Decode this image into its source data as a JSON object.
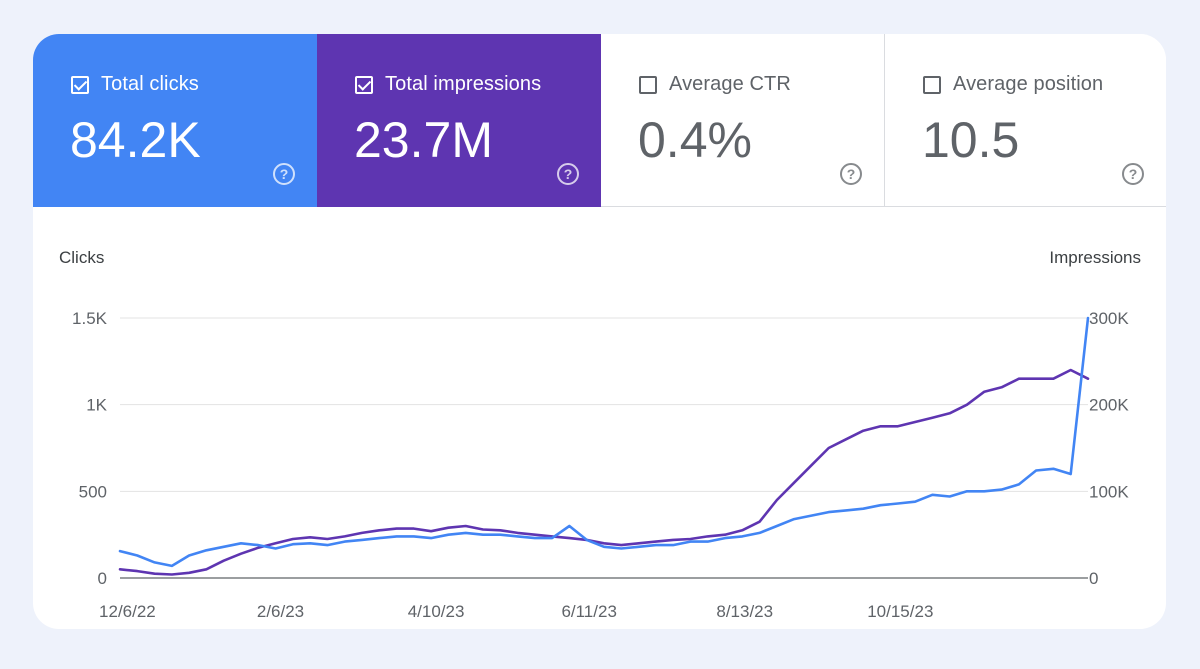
{
  "metrics": [
    {
      "label": "Total clicks",
      "value": "84.2K",
      "checked": true,
      "color": "#4285f4"
    },
    {
      "label": "Total impressions",
      "value": "23.7M",
      "checked": true,
      "color": "#5e35b1"
    },
    {
      "label": "Average CTR",
      "value": "0.4%",
      "checked": false
    },
    {
      "label": "Average position",
      "value": "10.5",
      "checked": false
    }
  ],
  "help_glyph": "?",
  "chart_data": {
    "type": "line",
    "y_left_label": "Clicks",
    "y_right_label": "Impressions",
    "y_left_ticks": [
      "0",
      "500",
      "1K",
      "1.5K"
    ],
    "y_left_range": [
      0,
      1500
    ],
    "y_right_ticks": [
      "0",
      "100K",
      "200K",
      "300K"
    ],
    "y_right_range": [
      0,
      300000
    ],
    "x_tick_labels": [
      "12/6/22",
      "2/6/23",
      "4/10/23",
      "6/11/23",
      "8/13/23",
      "10/15/23"
    ],
    "x_tick_dates": [
      "2022-12-06",
      "2023-02-06",
      "2023-04-10",
      "2023-06-11",
      "2023-08-13",
      "2023-10-15"
    ],
    "x_range": [
      "2022-12-03",
      "2023-12-30"
    ],
    "grid": true,
    "series": [
      {
        "name": "Total clicks",
        "axis": "left",
        "color": "#4285f4",
        "dates": [
          "2022-12-03",
          "2022-12-10",
          "2022-12-17",
          "2022-12-24",
          "2022-12-31",
          "2023-01-07",
          "2023-01-14",
          "2023-01-21",
          "2023-01-28",
          "2023-02-04",
          "2023-02-11",
          "2023-02-18",
          "2023-02-25",
          "2023-03-04",
          "2023-03-11",
          "2023-03-18",
          "2023-03-25",
          "2023-04-01",
          "2023-04-08",
          "2023-04-15",
          "2023-04-22",
          "2023-04-29",
          "2023-05-06",
          "2023-05-13",
          "2023-05-20",
          "2023-05-27",
          "2023-06-03",
          "2023-06-10",
          "2023-06-17",
          "2023-06-24",
          "2023-07-01",
          "2023-07-08",
          "2023-07-15",
          "2023-07-22",
          "2023-07-29",
          "2023-08-05",
          "2023-08-12",
          "2023-08-19",
          "2023-08-26",
          "2023-09-02",
          "2023-09-09",
          "2023-09-16",
          "2023-09-23",
          "2023-09-30",
          "2023-10-07",
          "2023-10-14",
          "2023-10-21",
          "2023-10-28",
          "2023-11-04",
          "2023-11-11",
          "2023-11-18",
          "2023-11-25",
          "2023-12-02",
          "2023-12-09",
          "2023-12-16",
          "2023-12-23",
          "2023-12-30"
        ],
        "values": [
          155,
          130,
          90,
          70,
          130,
          160,
          180,
          200,
          190,
          170,
          195,
          200,
          190,
          210,
          220,
          230,
          240,
          240,
          230,
          250,
          260,
          250,
          250,
          240,
          230,
          230,
          300,
          220,
          180,
          170,
          180,
          190,
          190,
          210,
          210,
          230,
          240,
          260,
          300,
          340,
          360,
          380,
          390,
          400,
          420,
          430,
          440,
          480,
          470,
          500,
          500,
          510,
          540,
          620,
          630,
          600,
          1500
        ]
      },
      {
        "name": "Total impressions",
        "axis": "right",
        "color": "#5e35b1",
        "dates": [
          "2022-12-03",
          "2022-12-10",
          "2022-12-17",
          "2022-12-24",
          "2022-12-31",
          "2023-01-07",
          "2023-01-14",
          "2023-01-21",
          "2023-01-28",
          "2023-02-04",
          "2023-02-11",
          "2023-02-18",
          "2023-02-25",
          "2023-03-04",
          "2023-03-11",
          "2023-03-18",
          "2023-03-25",
          "2023-04-01",
          "2023-04-08",
          "2023-04-15",
          "2023-04-22",
          "2023-04-29",
          "2023-05-06",
          "2023-05-13",
          "2023-05-20",
          "2023-05-27",
          "2023-06-03",
          "2023-06-10",
          "2023-06-17",
          "2023-06-24",
          "2023-07-01",
          "2023-07-08",
          "2023-07-15",
          "2023-07-22",
          "2023-07-29",
          "2023-08-05",
          "2023-08-12",
          "2023-08-19",
          "2023-08-26",
          "2023-09-02",
          "2023-09-09",
          "2023-09-16",
          "2023-09-23",
          "2023-09-30",
          "2023-10-07",
          "2023-10-14",
          "2023-10-21",
          "2023-10-28",
          "2023-11-04",
          "2023-11-11",
          "2023-11-18",
          "2023-11-25",
          "2023-12-02",
          "2023-12-09",
          "2023-12-16",
          "2023-12-23",
          "2023-12-30"
        ],
        "values": [
          10000,
          8000,
          5000,
          4000,
          6000,
          10000,
          20000,
          28000,
          35000,
          40000,
          45000,
          47000,
          45000,
          48000,
          52000,
          55000,
          57000,
          57000,
          54000,
          58000,
          60000,
          56000,
          55000,
          52000,
          50000,
          48000,
          46000,
          44000,
          40000,
          38000,
          40000,
          42000,
          44000,
          45000,
          48000,
          50000,
          55000,
          65000,
          90000,
          110000,
          130000,
          150000,
          160000,
          170000,
          175000,
          175000,
          180000,
          185000,
          190000,
          200000,
          215000,
          220000,
          230000,
          230000,
          230000,
          240000,
          230000
        ]
      }
    ]
  }
}
